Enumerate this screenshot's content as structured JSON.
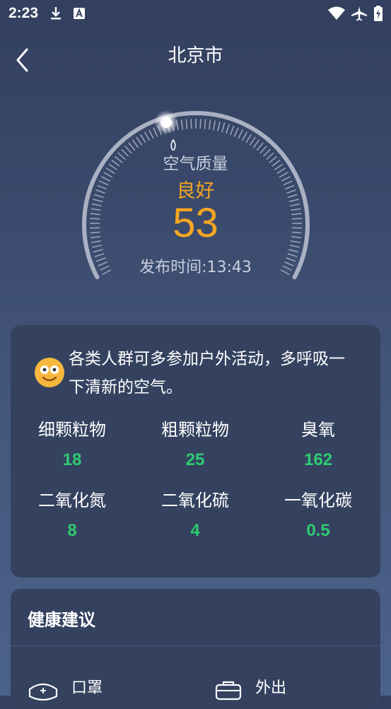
{
  "status": {
    "time": "2:23"
  },
  "header": {
    "title": "北京市"
  },
  "gauge": {
    "label": "空气质量",
    "level": "良好",
    "value": "53",
    "publish_time": "发布时间:13:43",
    "aqi": 53
  },
  "card": {
    "message": "各类人群可多参加户外活动，多呼吸一下清新的空气。",
    "pollutants": [
      {
        "name": "细颗粒物",
        "value": "18"
      },
      {
        "name": "粗颗粒物",
        "value": "25"
      },
      {
        "name": "臭氧",
        "value": "162"
      },
      {
        "name": "二氧化氮",
        "value": "8"
      },
      {
        "name": "二氧化硫",
        "value": "4"
      },
      {
        "name": "一氧化碳",
        "value": "0.5"
      }
    ],
    "value_color": "#2ecc71"
  },
  "advice": {
    "title": "健康建议",
    "items": [
      {
        "label": "口罩",
        "icon": "mask-icon"
      },
      {
        "label": "外出",
        "icon": "bag-icon"
      }
    ]
  },
  "colors": {
    "accent": "#f5a623"
  }
}
